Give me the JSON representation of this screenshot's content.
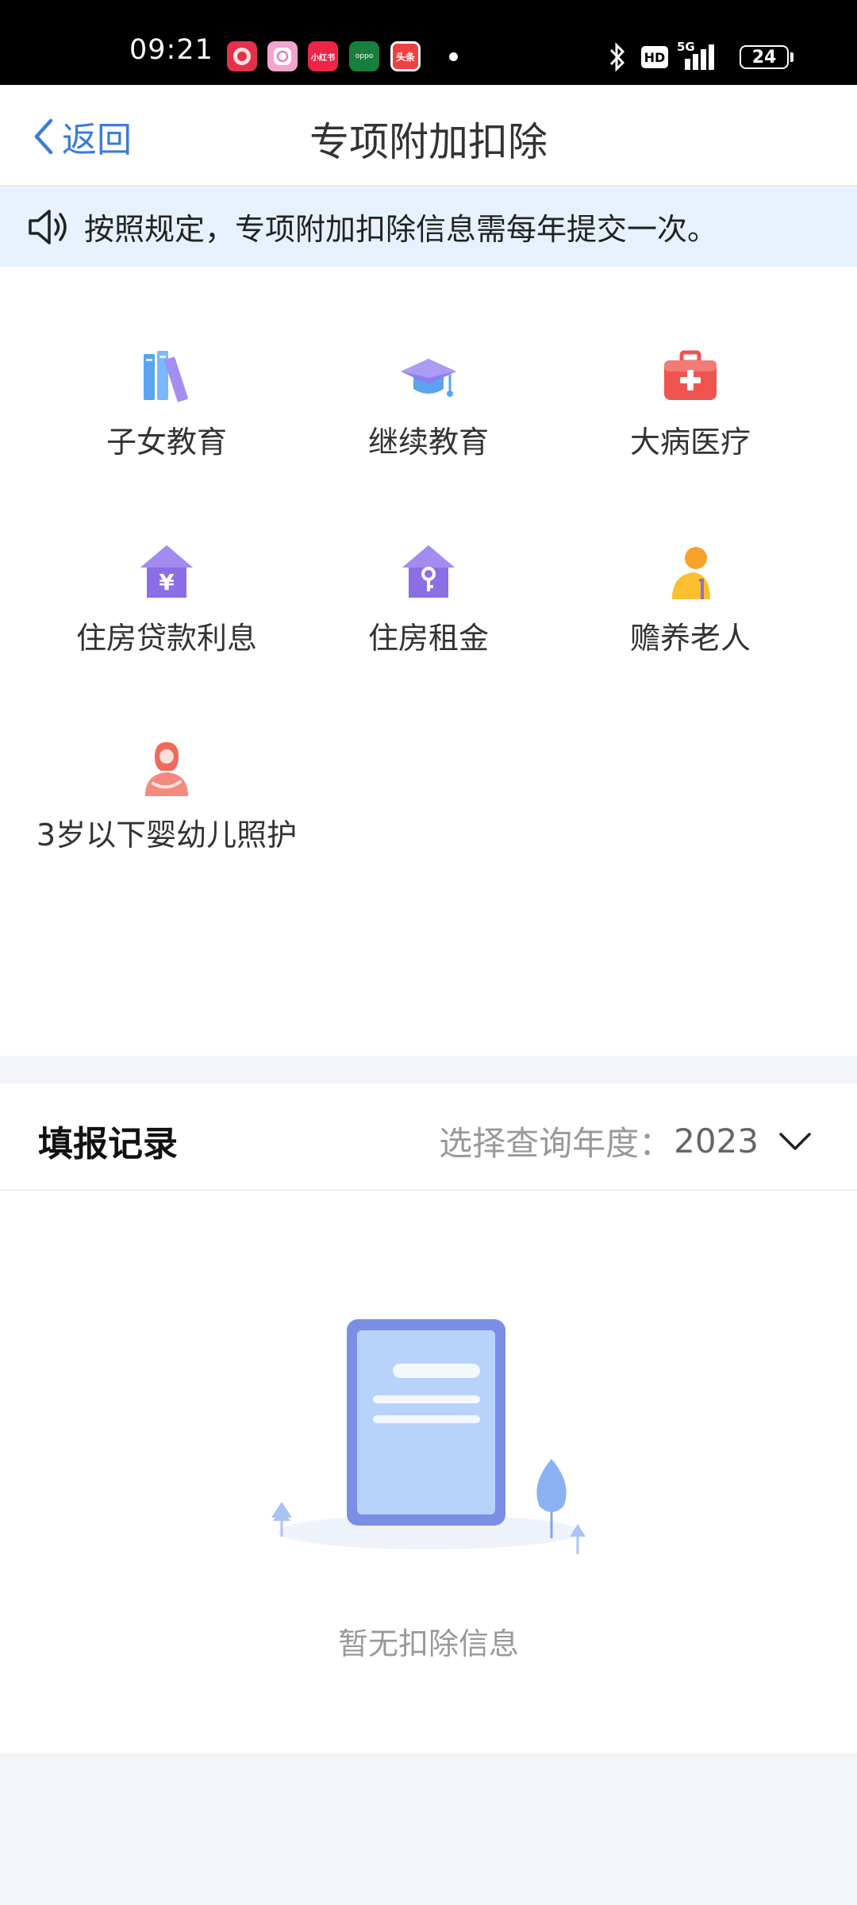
{
  "status_bar": {
    "time": "09:21",
    "notifications": [
      {
        "icon": "red-envelope-app-icon",
        "color": "#e2324a",
        "label": ""
      },
      {
        "icon": "camera-app-icon",
        "color": "#f07ab8",
        "label": ""
      },
      {
        "icon": "xiaohongshu-app-icon",
        "color": "#ee2545",
        "label": "小红书"
      },
      {
        "icon": "oppo-app-icon",
        "color": "#1a7f3c",
        "label": "oppo"
      },
      {
        "icon": "toutiao-app-icon",
        "color": "#f04142",
        "label": "头条"
      }
    ],
    "hd": "HD",
    "network": "5G",
    "battery": "24"
  },
  "nav": {
    "back_label": "返回",
    "title": "专项附加扣除"
  },
  "notice": {
    "text": "按照规定，专项附加扣除信息需每年提交一次。"
  },
  "categories": [
    {
      "label": "子女教育",
      "icon": "books-icon"
    },
    {
      "label": "继续教育",
      "icon": "graduation-cap-icon"
    },
    {
      "label": "大病医疗",
      "icon": "medical-kit-icon"
    },
    {
      "label": "住房贷款利息",
      "icon": "house-yuan-icon"
    },
    {
      "label": "住房租金",
      "icon": "house-key-icon"
    },
    {
      "label": "赡养老人",
      "icon": "elderly-person-icon"
    },
    {
      "label": "3岁以下婴幼儿照护",
      "icon": "mother-baby-icon"
    }
  ],
  "records": {
    "title": "填报记录",
    "year_prompt": "选择查询年度：",
    "year_value": "2023",
    "empty_text": "暂无扣除信息"
  },
  "colors": {
    "accent": "#3d7bd9",
    "notice_bg": "#e6f1fd",
    "icon_purple": "#8b6ee6",
    "icon_red": "#ef5350",
    "icon_orange": "#f7a22b"
  }
}
